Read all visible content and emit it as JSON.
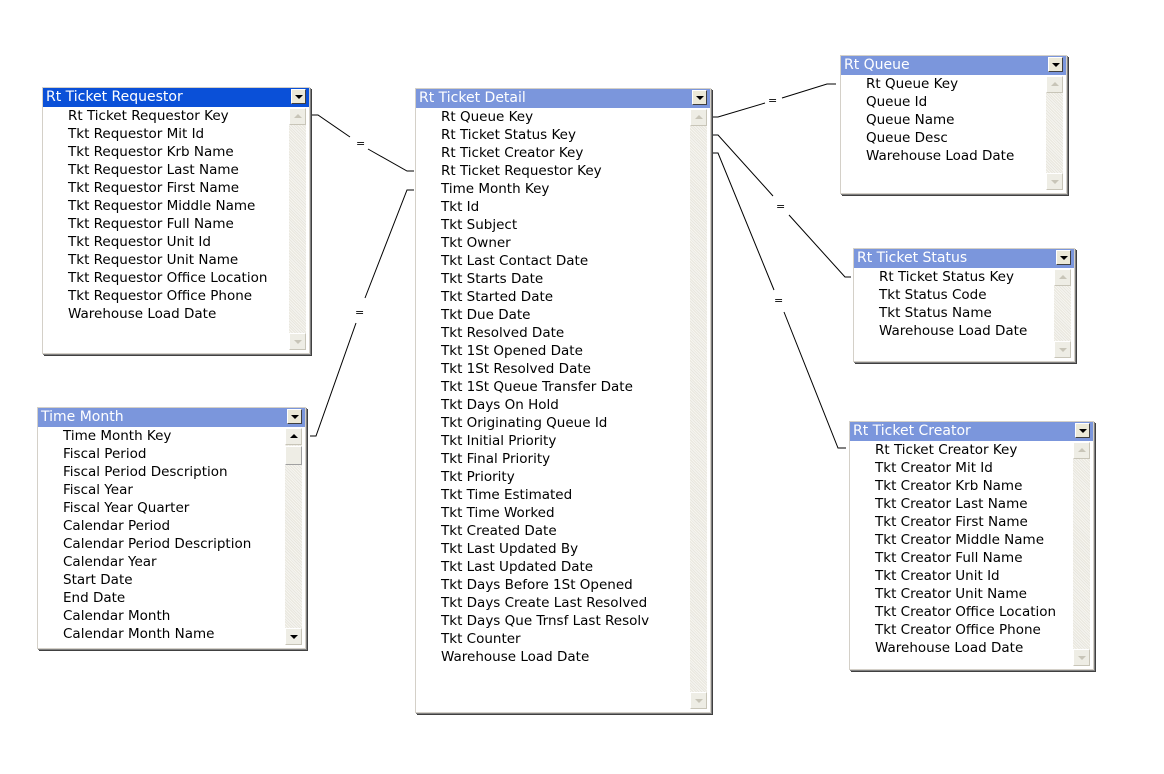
{
  "tables": {
    "requestor": {
      "title": "Rt Ticket Requestor",
      "columns": [
        "Rt Ticket Requestor Key",
        "Tkt Requestor Mit Id",
        "Tkt Requestor Krb Name",
        "Tkt Requestor Last Name",
        "Tkt Requestor First Name",
        "Tkt Requestor Middle Name",
        "Tkt Requestor Full Name",
        "Tkt Requestor Unit Id",
        "Tkt Requestor Unit Name",
        "Tkt Requestor Office Location",
        "Tkt Requestor Office Phone",
        "Warehouse Load Date"
      ]
    },
    "time_month": {
      "title": "Time Month",
      "columns": [
        "Time Month Key",
        "Fiscal Period",
        "Fiscal Period Description",
        "Fiscal Year",
        "Fiscal Year Quarter",
        "Calendar Period",
        "Calendar Period Description",
        "Calendar Year",
        "Start Date",
        "End Date",
        "Calendar Month",
        "Calendar Month Name"
      ]
    },
    "detail": {
      "title": "Rt Ticket Detail",
      "columns": [
        "Rt Queue Key",
        "Rt Ticket Status Key",
        "Rt Ticket Creator Key",
        "Rt Ticket Requestor Key",
        "Time Month Key",
        "Tkt Id",
        "Tkt Subject",
        "Tkt Owner",
        "Tkt Last Contact Date",
        "Tkt Starts Date",
        "Tkt Started Date",
        "Tkt Due Date",
        "Tkt Resolved Date",
        "Tkt 1St Opened Date",
        "Tkt 1St Resolved Date",
        "Tkt 1St Queue Transfer Date",
        "Tkt Days On Hold",
        "Tkt Originating Queue Id",
        "Tkt Initial Priority",
        "Tkt Final Priority",
        "Tkt Priority",
        "Tkt Time Estimated",
        "Tkt Time Worked",
        "Tkt Created Date",
        "Tkt Last Updated By",
        "Tkt Last Updated Date",
        "Tkt Days Before 1St Opened",
        "Tkt Days Create Last Resolved",
        "Tkt Days Que Trnsf Last Resolv",
        "Tkt Counter",
        "Warehouse Load Date"
      ]
    },
    "queue": {
      "title": "Rt Queue",
      "columns": [
        "Rt Queue Key",
        "Queue Id",
        "Queue Name",
        "Queue Desc",
        "Warehouse Load Date"
      ]
    },
    "status": {
      "title": "Rt Ticket Status",
      "columns": [
        "Rt Ticket Status Key",
        "Tkt Status Code",
        "Tkt Status Name",
        "Warehouse Load Date"
      ]
    },
    "creator": {
      "title": "Rt Ticket Creator",
      "columns": [
        "Rt Ticket Creator Key",
        "Tkt Creator Mit Id",
        "Tkt Creator Krb Name",
        "Tkt Creator Last Name",
        "Tkt Creator First Name",
        "Tkt Creator Middle Name",
        "Tkt Creator Full Name",
        "Tkt Creator Unit Id",
        "Tkt Creator Unit Name",
        "Tkt Creator Office Location",
        "Tkt Creator Office Phone",
        "Warehouse Load Date"
      ]
    }
  },
  "joins": [
    {
      "from": "requestor",
      "from_column": "Rt Ticket Requestor Key",
      "to": "detail",
      "to_column": "Rt Ticket Requestor Key",
      "operator": "="
    },
    {
      "from": "time_month",
      "from_column": "Time Month Key",
      "to": "detail",
      "to_column": "Time Month Key",
      "operator": "="
    },
    {
      "from": "detail",
      "from_column": "Rt Queue Key",
      "to": "queue",
      "to_column": "Rt Queue Key",
      "operator": "="
    },
    {
      "from": "detail",
      "from_column": "Rt Ticket Status Key",
      "to": "status",
      "to_column": "Rt Ticket Status Key",
      "operator": "="
    },
    {
      "from": "detail",
      "from_column": "Rt Ticket Creator Key",
      "to": "creator",
      "to_column": "Rt Ticket Creator Key",
      "operator": "="
    }
  ],
  "active_table": "requestor"
}
